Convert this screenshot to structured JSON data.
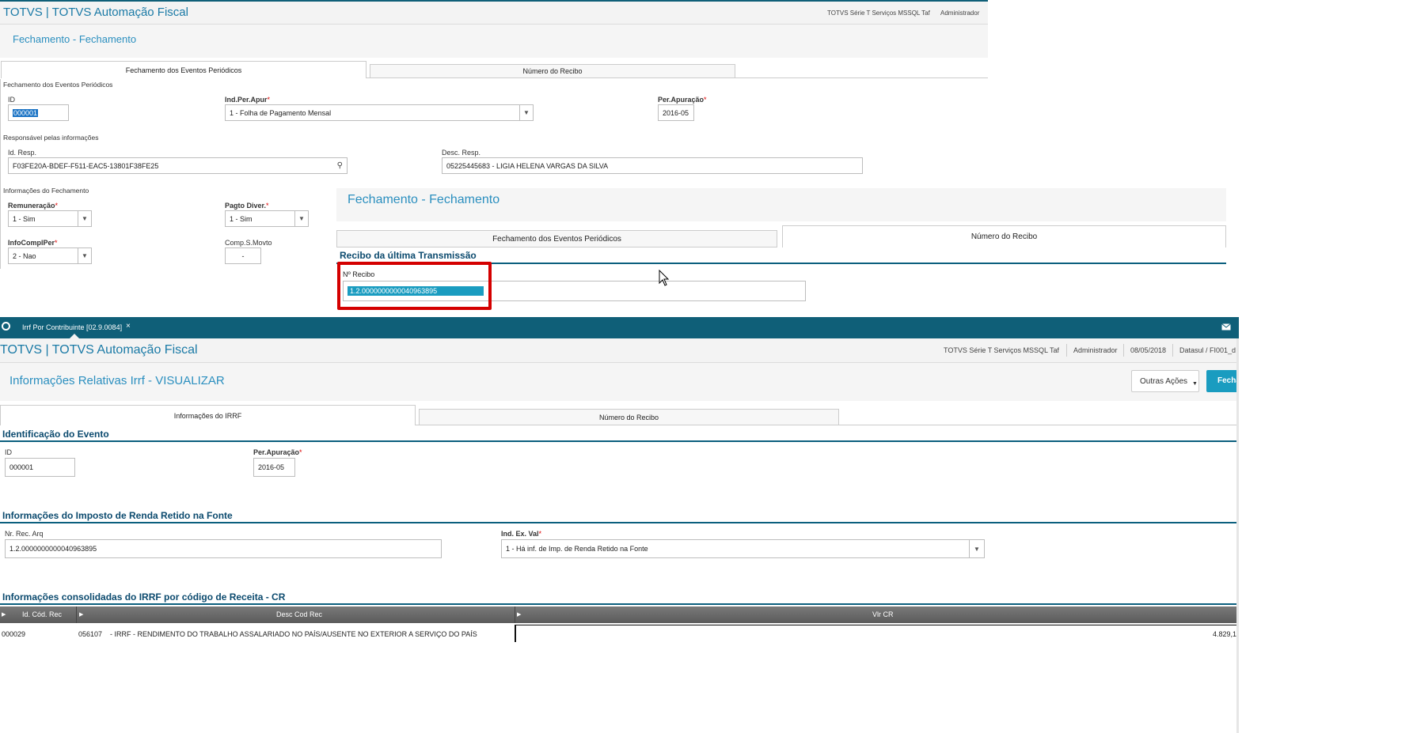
{
  "s1": {
    "app_title": "TOTVS | TOTVS Automação Fiscal",
    "server": "TOTVS Série T Serviços MSSQL Taf",
    "user": "Administrador",
    "page_title": "Fechamento - Fechamento",
    "tabs": [
      "Fechamento dos Eventos Periódicos",
      "Número do Recibo"
    ],
    "section_label": "Fechamento dos Eventos Periódicos",
    "id_label": "ID",
    "id_value": "000001",
    "ind_label": "Ind.Per.Apur",
    "ind_value": "1 - Folha de Pagamento Mensal",
    "per_label": "Per.Apuração",
    "per_value": "2016-05",
    "resp_section": "Responsável pelas informações",
    "idresp_label": "Id. Resp.",
    "idresp_value": "F03FE20A-BDEF-F511-EAC5-13801F38FE25",
    "descresp_label": "Desc. Resp.",
    "descresp_value": "05225445683 - LIGIA HELENA VARGAS DA SILVA",
    "info_section": "Informações do Fechamento",
    "remun_label": "Remuneração",
    "remun_value": "1 - Sim",
    "pagto_label": "Pagto Diver.",
    "pagto_value": "1 - Sim",
    "infocompl_label": "InfoComplPer",
    "infocompl_value": "2 - Nao",
    "comp_label": "Comp.S.Movto",
    "comp_value": "-"
  },
  "s2": {
    "page_title": "Fechamento - Fechamento",
    "tabs": [
      "Fechamento dos Eventos Periódicos",
      "Número do Recibo"
    ],
    "section_title": "Recibo da última Transmissão",
    "recibo_label": "Nº Recibo",
    "recibo_value": "1.2.0000000000040963895"
  },
  "s3": {
    "tab_label": "Irrf Por Contribuinte [02.9.0084]",
    "tab_close": "×",
    "app_title": "TOTVS | TOTVS Automação Fiscal",
    "server": "TOTVS Série T Serviços MSSQL Taf",
    "user": "Administrador",
    "date": "08/05/2018",
    "env": "Datasul / FI001_d",
    "page_title": "Informações Relativas Irrf - VISUALIZAR",
    "outras_label": "Outras Ações",
    "fechar_label": "Fecha",
    "tabs": [
      "Informações do IRRF",
      "Número do Recibo"
    ],
    "ident_title": "Identificação do Evento",
    "id_label": "ID",
    "id_value": "000001",
    "per_label": "Per.Apuração",
    "per_value": "2016-05",
    "imposto_title": "Informações do Imposto de Renda Retido na Fonte",
    "nrrec_label": "Nr. Rec. Arq",
    "nrrec_value": "1.2.0000000000040963895",
    "index_label": "Ind. Ex. Val",
    "index_value": "1 - Há inf. de Imp. de Renda Retido na Fonte",
    "consol_title": "Informações consolidadas do IRRF por código de Receita - CR",
    "columns": [
      "Id. Cód. Rec",
      "Desc Cod Rec",
      "Vlr CR"
    ],
    "rows": [
      {
        "id": "000029",
        "code": "056107",
        "desc": "- IRRF - RENDIMENTO DO TRABALHO ASSALARIADO NO PAÍS/AUSENTE NO EXTERIOR A SERVIÇO DO PAÍS",
        "vlr": "4.829,1"
      }
    ]
  },
  "colors": {
    "teal": "#1a9cc0",
    "dark_bar": "#0f5f78",
    "title_blue": "#2b8fbf",
    "highlight_red": "#d40000"
  }
}
